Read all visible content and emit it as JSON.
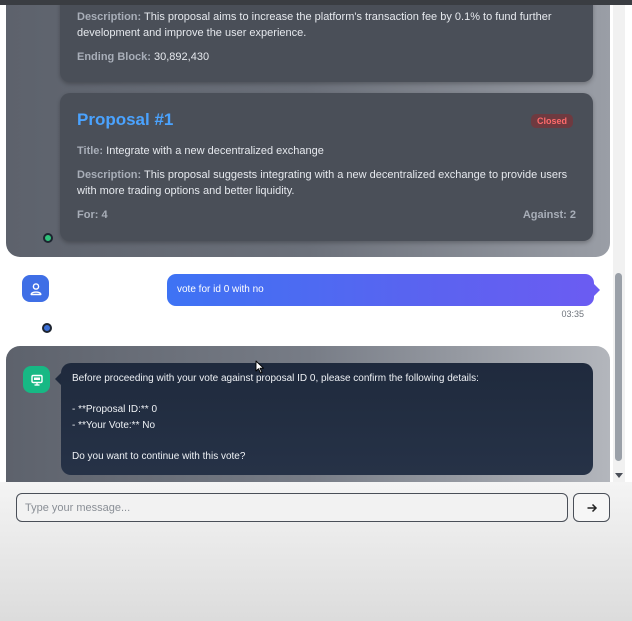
{
  "proposal_0_partial": {
    "description_label": "Description:",
    "description_line1": "This proposal aims to increase the platform's transaction fee by 0.1% to fund further",
    "description_line2": "development and improve the user experience.",
    "ending_block_label": "Ending Block:",
    "ending_block_value": "30,892,430"
  },
  "proposal_1": {
    "heading": "Proposal #1",
    "status": "Closed",
    "title_label": "Title:",
    "title_value": "Integrate with a new decentralized exchange",
    "description_label": "Description:",
    "description_line1": "This proposal suggests integrating with a new decentralized exchange to provide users",
    "description_line2": "with more trading options and better liquidity.",
    "for_label": "For: 4",
    "against_label": "Against: 2"
  },
  "user_message": {
    "text": "vote for id 0 with no",
    "time": "03:35"
  },
  "bot_message": {
    "line1": "Before proceeding with your vote against proposal ID 0, please confirm the following details:",
    "line2": "- **Proposal ID:** 0",
    "line3": "- **Your Vote:** No",
    "line4": "Do you want to continue with this vote?"
  },
  "composer": {
    "placeholder": "Type your message..."
  },
  "icons": {
    "user_avatar": "user-icon",
    "bot_avatar": "robot-icon",
    "send": "arrow-right-icon"
  },
  "colors": {
    "accent_blue": "#4aa3ff",
    "closed_badge": "#ff6b6b",
    "user_avatar_bg": "#3f6fe6",
    "bot_avatar_bg": "#17b884"
  }
}
